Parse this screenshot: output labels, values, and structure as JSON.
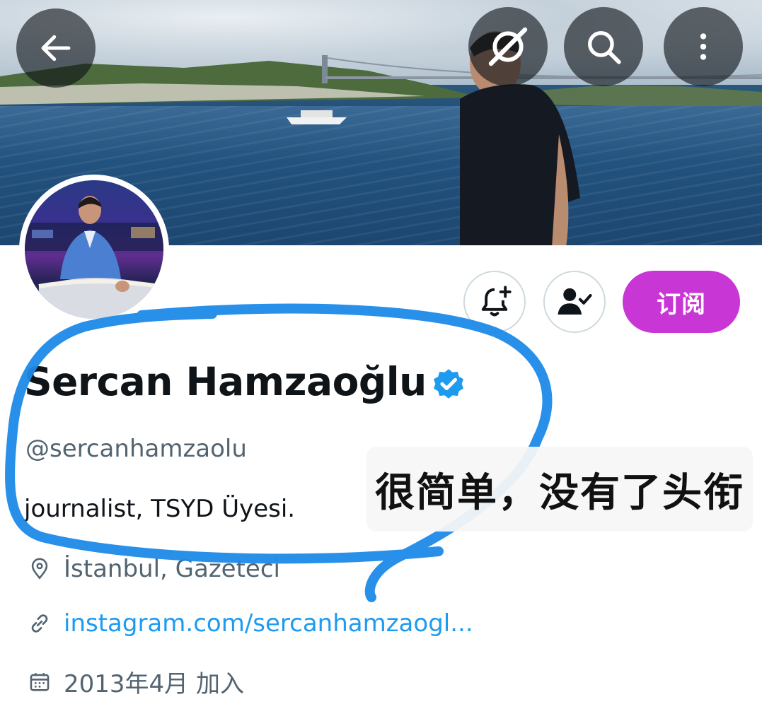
{
  "header": {
    "back_icon": "arrow-left-icon",
    "grok_icon": "grok-icon",
    "search_icon": "search-icon",
    "more_icon": "more-vertical-icon"
  },
  "actions": {
    "notify_icon": "bell-plus-icon",
    "following_icon": "person-check-icon",
    "subscribe_label": "订阅",
    "subscribe_color": "#c936d6"
  },
  "profile": {
    "display_name": "Sercan Hamzaoğlu",
    "verified_icon": "verified-badge-icon",
    "verified_color": "#1d9bf0",
    "handle": "@sercanhamzaolu",
    "bio": "journalist, TSYD Üyesi.",
    "location": "İstanbul, Gazeteci",
    "website": "instagram.com/sercanhamzaogl...",
    "joined": "2013年4月 加入"
  },
  "annotation": {
    "note_text": "很简单，没有了头衔",
    "scribble_color": "#1e8ae8"
  }
}
